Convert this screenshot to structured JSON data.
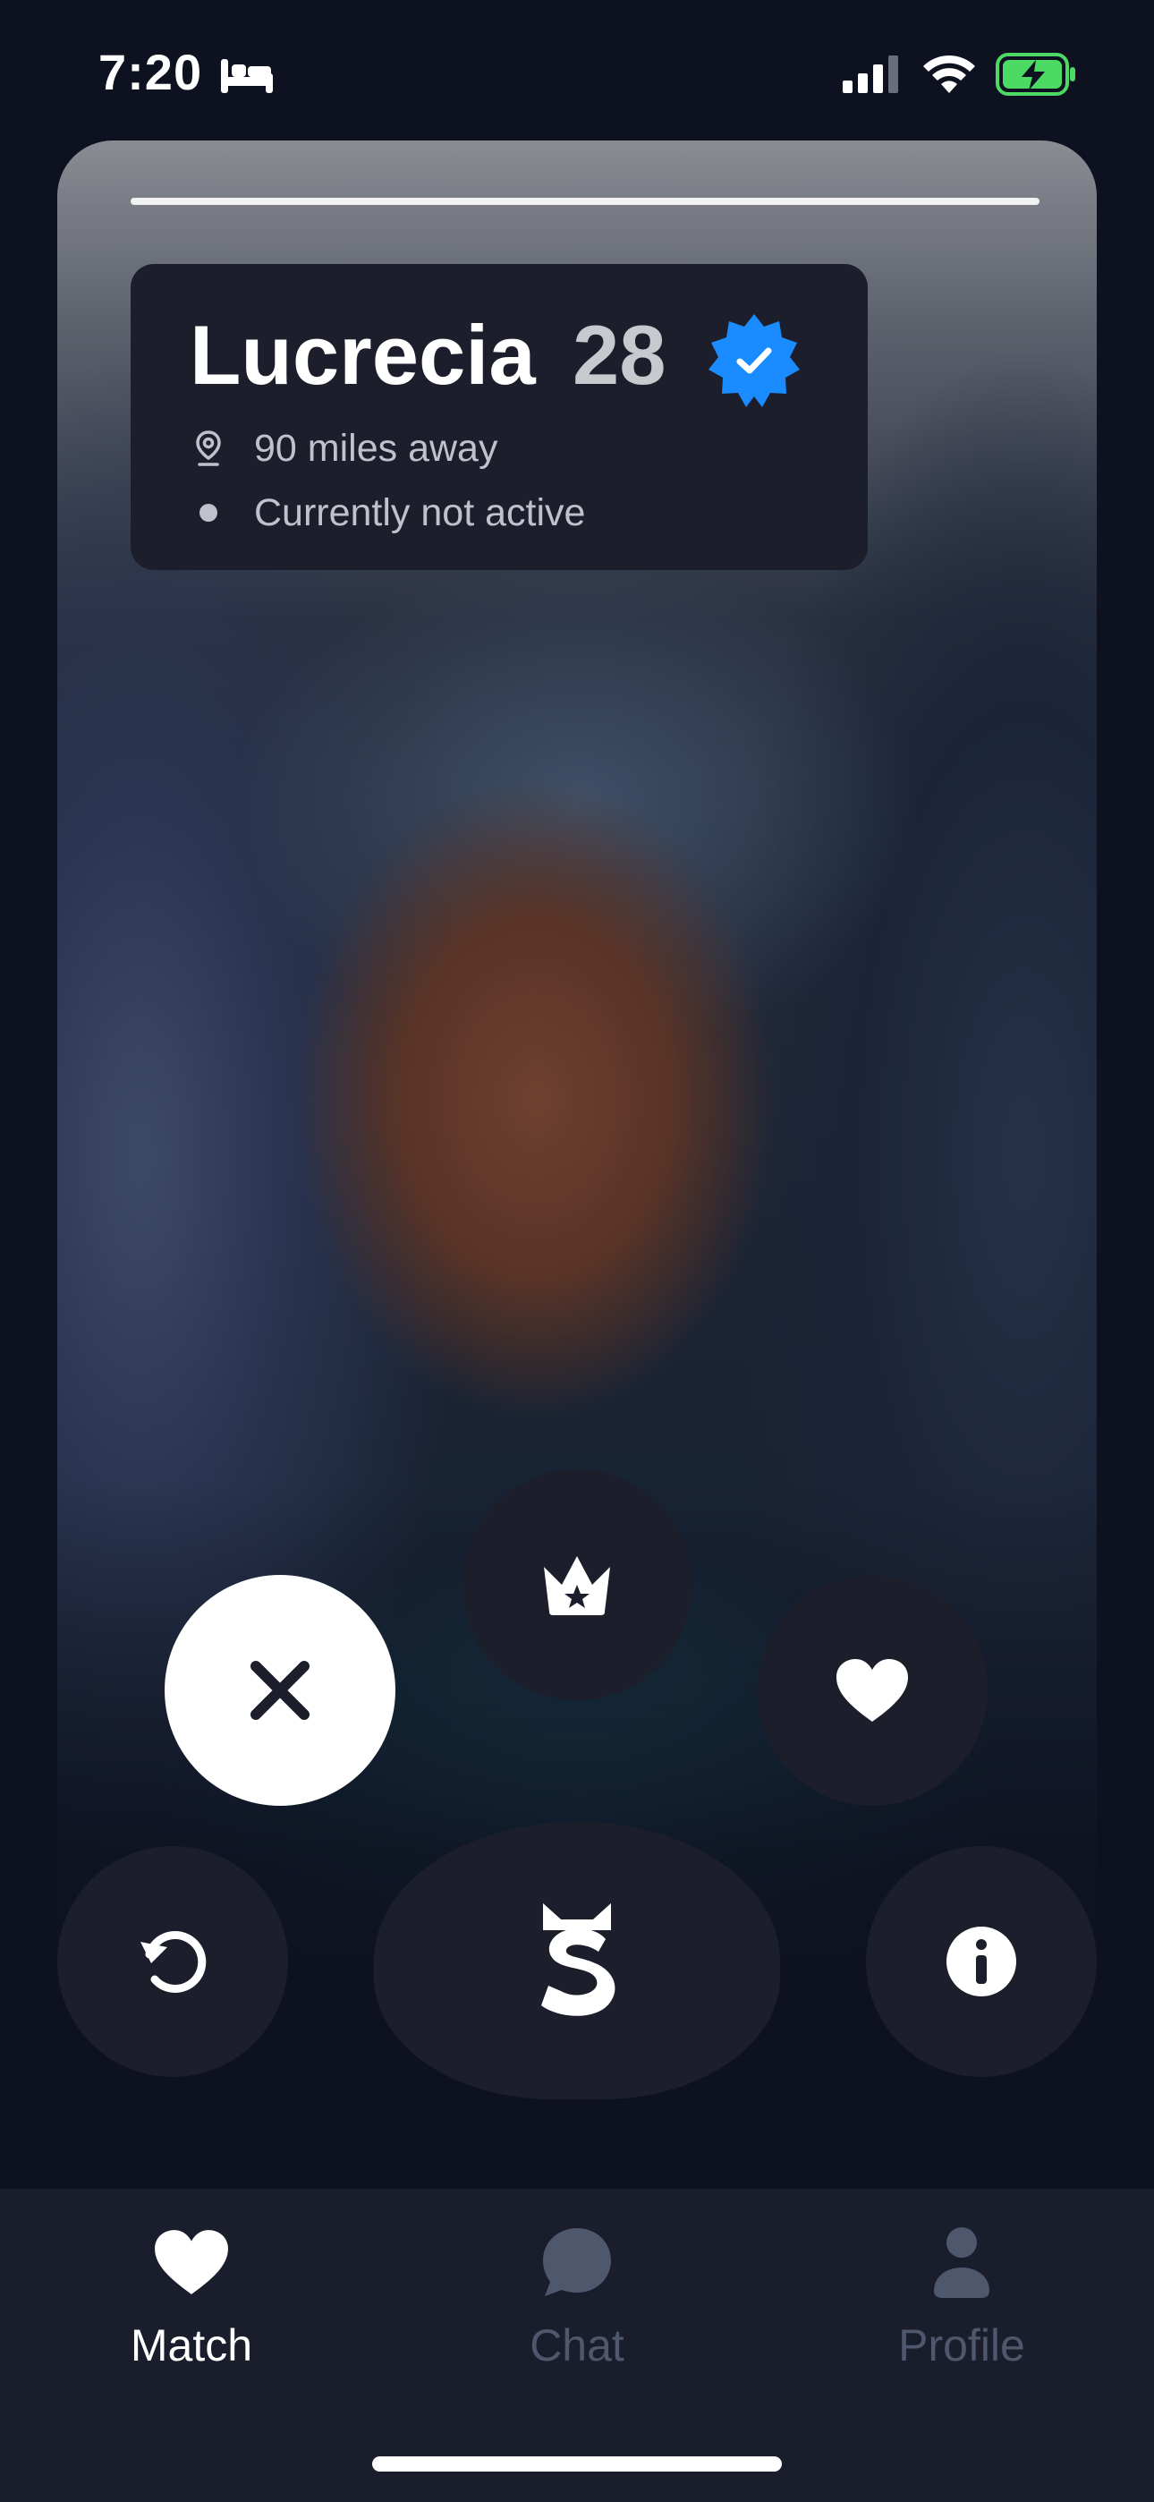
{
  "status_bar": {
    "time": "7:20",
    "focus_icon": "bed-icon",
    "signal_icon": "cellular-signal-icon",
    "wifi_icon": "wifi-icon",
    "battery_icon": "battery-charging-icon",
    "battery_color": "#4cd964"
  },
  "profile_card": {
    "photo_progress_fraction": 1.0,
    "name": "Lucrecia",
    "age": "28",
    "verified_icon": "verified-badge-icon",
    "verified_color": "#1a8cff",
    "distance": "90 miles away",
    "distance_icon": "location-pin-icon",
    "activity_status": "Currently not active"
  },
  "actions": {
    "super_like_icon": "crown-icon",
    "nope_icon": "close-icon",
    "like_icon": "heart-icon",
    "rewind_icon": "undo-icon",
    "boost_icon": "s-logo-icon",
    "info_icon": "info-icon"
  },
  "tab_bar": {
    "tabs": [
      {
        "label": "Match",
        "icon": "heart-icon",
        "active": true
      },
      {
        "label": "Chat",
        "icon": "chat-bubble-icon",
        "active": false
      },
      {
        "label": "Profile",
        "icon": "person-icon",
        "active": false
      }
    ],
    "active_color": "#ffffff",
    "inactive_color": "#4f576d"
  }
}
